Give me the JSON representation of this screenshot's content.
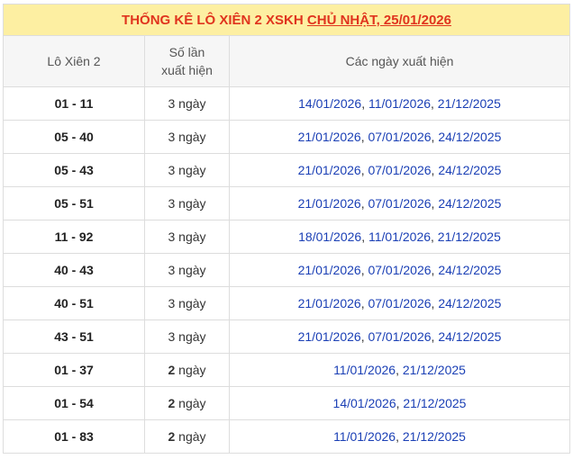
{
  "title": {
    "prefix": "THỐNG KÊ LÔ XIÊN 2 XSKH ",
    "link": "CHỦ NHẬT, 25/01/2026"
  },
  "headers": {
    "pair": "Lô Xiên 2",
    "count": "Số lần xuất hiện",
    "dates": "Các ngày xuất hiện"
  },
  "rows": [
    {
      "pair": "01 - 11",
      "count": "3",
      "unit": " ngày",
      "bold": false,
      "dates": [
        "14/01/2026",
        "11/01/2026",
        "21/12/2025"
      ]
    },
    {
      "pair": "05 - 40",
      "count": "3",
      "unit": " ngày",
      "bold": false,
      "dates": [
        "21/01/2026",
        "07/01/2026",
        "24/12/2025"
      ]
    },
    {
      "pair": "05 - 43",
      "count": "3",
      "unit": " ngày",
      "bold": false,
      "dates": [
        "21/01/2026",
        "07/01/2026",
        "24/12/2025"
      ]
    },
    {
      "pair": "05 - 51",
      "count": "3",
      "unit": " ngày",
      "bold": false,
      "dates": [
        "21/01/2026",
        "07/01/2026",
        "24/12/2025"
      ]
    },
    {
      "pair": "11 - 92",
      "count": "3",
      "unit": " ngày",
      "bold": false,
      "dates": [
        "18/01/2026",
        "11/01/2026",
        "21/12/2025"
      ]
    },
    {
      "pair": "40 - 43",
      "count": "3",
      "unit": " ngày",
      "bold": false,
      "dates": [
        "21/01/2026",
        "07/01/2026",
        "24/12/2025"
      ]
    },
    {
      "pair": "40 - 51",
      "count": "3",
      "unit": " ngày",
      "bold": false,
      "dates": [
        "21/01/2026",
        "07/01/2026",
        "24/12/2025"
      ]
    },
    {
      "pair": "43 - 51",
      "count": "3",
      "unit": " ngày",
      "bold": false,
      "dates": [
        "21/01/2026",
        "07/01/2026",
        "24/12/2025"
      ]
    },
    {
      "pair": "01 - 37",
      "count": "2",
      "unit": " ngày",
      "bold": true,
      "dates": [
        "11/01/2026",
        "21/12/2025"
      ]
    },
    {
      "pair": "01 - 54",
      "count": "2",
      "unit": " ngày",
      "bold": true,
      "dates": [
        "14/01/2026",
        "21/12/2025"
      ]
    },
    {
      "pair": "01 - 83",
      "count": "2",
      "unit": " ngày",
      "bold": true,
      "dates": [
        "11/01/2026",
        "21/12/2025"
      ]
    }
  ],
  "separator": ", "
}
